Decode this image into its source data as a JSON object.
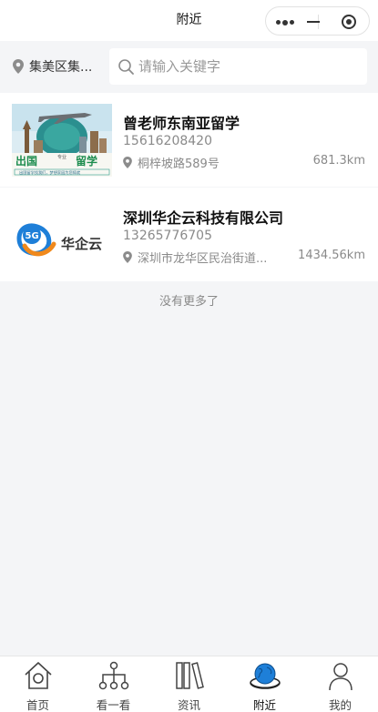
{
  "header": {
    "title": "附近"
  },
  "location": {
    "label": "集美区集..."
  },
  "search": {
    "placeholder": "请输入关键字",
    "value": ""
  },
  "results": [
    {
      "name": "曾老师东南亚留学",
      "phone": "15616208420",
      "address": "桐梓坡路589号",
      "distance": "681.3km",
      "thumb_text": {
        "left": "出国",
        "right": "留学",
        "tag": "专业",
        "bottom": "出国留学找我们，梦想家园为您铸就"
      }
    },
    {
      "name": "深圳华企云科技有限公司",
      "phone": "13265776705",
      "address": "深圳市龙华区民治街道...",
      "distance": "1434.56km",
      "logo_text": {
        "badge": "5G",
        "brand": "华企云"
      }
    }
  ],
  "footer_note": "没有更多了",
  "tabbar": {
    "items": [
      {
        "label": "首页",
        "icon": "home-icon"
      },
      {
        "label": "看一看",
        "icon": "network-icon"
      },
      {
        "label": "资讯",
        "icon": "books-icon"
      },
      {
        "label": "附近",
        "icon": "globe-icon",
        "active": true
      },
      {
        "label": "我的",
        "icon": "user-icon"
      }
    ]
  },
  "colors": {
    "accent": "#1e7fd8",
    "background": "#f4f5f7",
    "muted_text": "#8a8a8a"
  }
}
